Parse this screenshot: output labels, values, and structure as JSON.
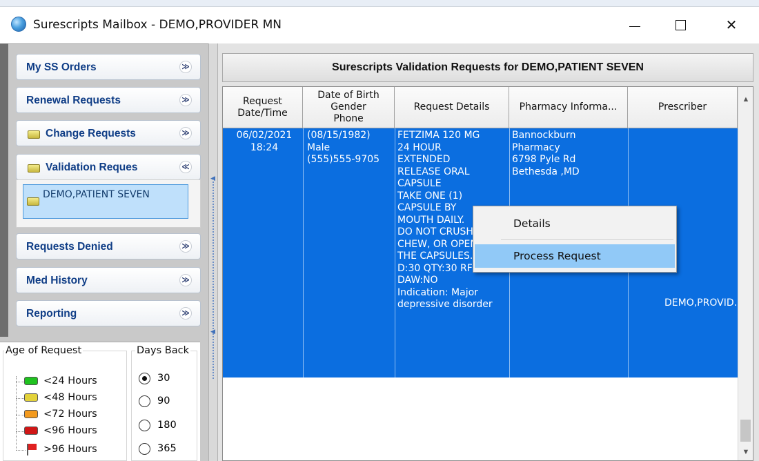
{
  "window": {
    "title": "Surescripts Mailbox - DEMO,PROVIDER MN",
    "minimize_glyph": "—",
    "maximize_glyph": "☐",
    "close_glyph": "✕"
  },
  "sidebar": {
    "groups": [
      {
        "label": "My SS Orders",
        "icon": null,
        "chevron": "≫"
      },
      {
        "label": "Renewal Requests",
        "icon": null,
        "chevron": "≫"
      },
      {
        "label": "Change Requests",
        "icon": "yellow-tag-icon",
        "chevron": "≫"
      },
      {
        "label": "Validation Reques",
        "icon": "yellow-tag-icon",
        "chevron": "≪"
      },
      {
        "label": "Requests Denied",
        "icon": null,
        "chevron": "≫"
      },
      {
        "label": "Med History",
        "icon": null,
        "chevron": "≫"
      },
      {
        "label": "Reporting",
        "icon": null,
        "chevron": "≫"
      }
    ],
    "validation_items": [
      {
        "label": "DEMO,PATIENT SEVEN"
      }
    ]
  },
  "legend": {
    "age_title": "Age of Request",
    "days_title": "Days Back",
    "ages": [
      {
        "label": "<24 Hours",
        "color": "#1fc21f"
      },
      {
        "label": "<48 Hours",
        "color": "#e3d23a"
      },
      {
        "label": "<72 Hours",
        "color": "#f39a1e"
      },
      {
        "label": "<96 Hours",
        "color": "#d01616"
      },
      {
        "label": ">96 Hours",
        "color": "#e02020"
      }
    ],
    "days": [
      {
        "label": "30",
        "selected": true
      },
      {
        "label": "90",
        "selected": false
      },
      {
        "label": "180",
        "selected": false
      },
      {
        "label": "365",
        "selected": false
      }
    ]
  },
  "main": {
    "header": "Surescripts Validation Requests for DEMO,PATIENT SEVEN",
    "columns": [
      "Request\nDate/Time",
      "Date of Birth\nGender\nPhone",
      "Request Details",
      "Pharmacy Informa...",
      "Prescriber"
    ],
    "rows": [
      {
        "datetime": "06/02/2021\n18:24",
        "dob_gender_phone": "(08/15/1982)\nMale\n(555)555-9705",
        "details": "FETZIMA 120 MG\n24 HOUR\nEXTENDED\nRELEASE ORAL\nCAPSULE\nTAKE ONE (1)\nCAPSULE BY\nMOUTH DAILY.\nDO NOT CRUSH,\nCHEW, OR OPEN\nTHE CAPSULES.\nD:30 QTY:30 RF:2\nDAW:NO\nIndication: Major\ndepressive disorder",
        "pharmacy": "Bannockburn\nPharmacy\n6798 Pyle Rd\nBethesda ,MD",
        "prescriber": "DEMO,PROVID..."
      }
    ]
  },
  "context_menu": {
    "items": [
      {
        "label": "Details",
        "highlighted": false
      },
      {
        "label": "Process Request",
        "highlighted": true
      }
    ]
  },
  "colors": {
    "selection": "#0b6ee0",
    "group_label": "#0f3d86",
    "menu_highlight": "#91c9f7"
  }
}
